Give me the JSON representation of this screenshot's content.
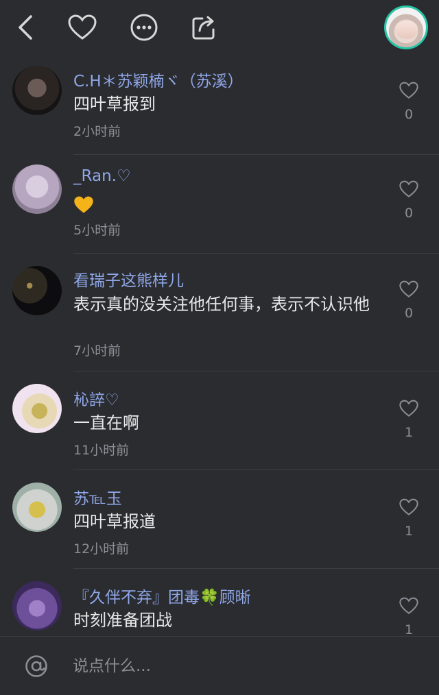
{
  "header": {
    "back_icon": "back-chevron-icon",
    "favorite_icon": "heart-outline-icon",
    "more_icon": "more-dots-icon",
    "share_icon": "share-icon"
  },
  "colors": {
    "background": "#2b2c30",
    "username": "#8fa7e8",
    "muted": "#8d8f96",
    "accent_ring": "#26c6a6",
    "heart_emoji": "#f5b31a"
  },
  "comments": [
    {
      "name": "C.H＊苏颖楠ヾ（苏溪）",
      "text": "四叶草报到",
      "time": "2小时前",
      "likes": "0"
    },
    {
      "name": "_Ran.♡",
      "text": "",
      "time": "5小时前",
      "likes": "0"
    },
    {
      "name": "看瑞子这熊样儿",
      "text": "表示真的没关注他任何事，表示不认识他",
      "time": "7小时前",
      "likes": "0"
    },
    {
      "name": "杺誶♡",
      "text": "一直在啊",
      "time": "11小时前",
      "likes": "1"
    },
    {
      "name": "苏℡玉",
      "text": "四叶草报道",
      "time": "12小时前",
      "likes": "1"
    },
    {
      "name": "『久伴不弃』团毒🍀顾晰",
      "text": "时刻准备团战",
      "time": "",
      "likes": "1"
    }
  ],
  "composer": {
    "placeholder": "说点什么..."
  }
}
